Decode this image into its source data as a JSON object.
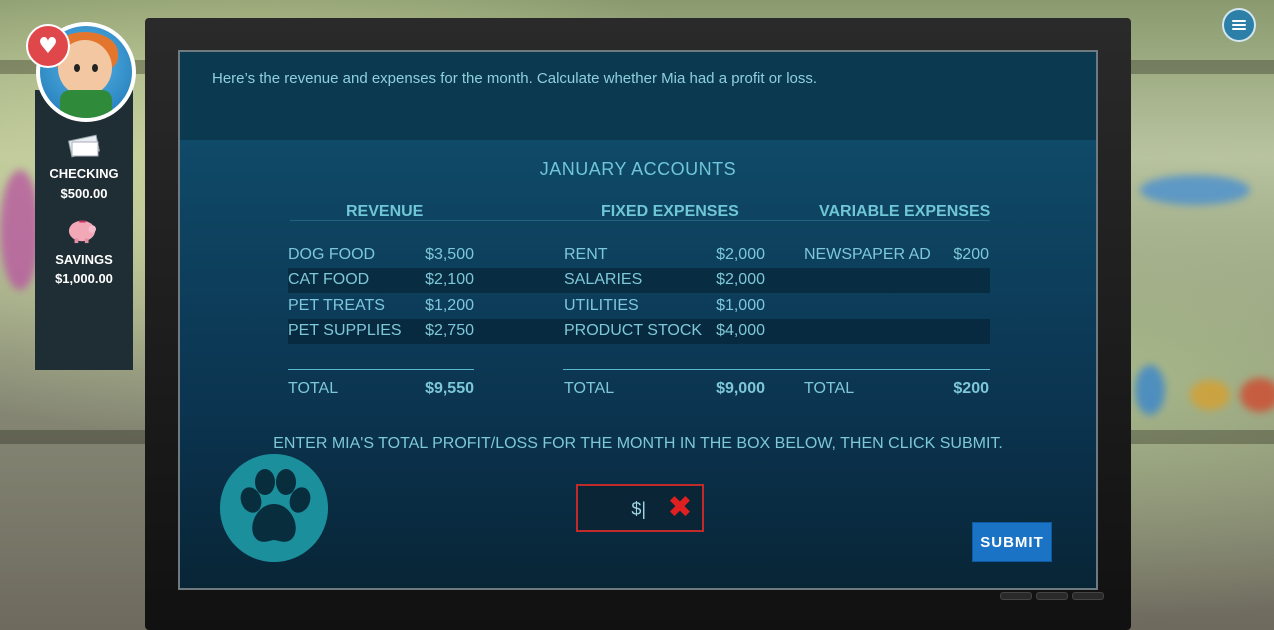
{
  "player": {
    "checking_label": "CHECKING",
    "checking_amount": "$500.00",
    "savings_label": "SAVINGS",
    "savings_amount": "$1,000.00"
  },
  "screen": {
    "instructions": "Here’s the revenue and expenses for the month. Calculate whether Mia had a profit or loss.",
    "title": "JANUARY ACCOUNTS",
    "revenue": {
      "heading": "REVENUE",
      "items": [
        {
          "label": "DOG FOOD",
          "amount": "$3,500"
        },
        {
          "label": "CAT FOOD",
          "amount": "$2,100"
        },
        {
          "label": "PET TREATS",
          "amount": "$1,200"
        },
        {
          "label": "PET SUPPLIES",
          "amount": "$2,750"
        }
      ],
      "total_label": "TOTAL",
      "total_amount": "$9,550"
    },
    "fixed": {
      "heading": "FIXED EXPENSES",
      "items": [
        {
          "label": "RENT",
          "amount": "$2,000"
        },
        {
          "label": "SALARIES",
          "amount": "$2,000"
        },
        {
          "label": "UTILITIES",
          "amount": "$1,000"
        },
        {
          "label": "PRODUCT STOCK",
          "amount": "$4,000"
        }
      ],
      "total_label": "TOTAL",
      "total_amount": "$9,000"
    },
    "variable": {
      "heading": "VARIABLE EXPENSES",
      "items": [
        {
          "label": "NEWSPAPER AD",
          "amount": "$200"
        }
      ],
      "total_label": "TOTAL",
      "total_amount": "$200"
    },
    "prompt": "ENTER MIA'S TOTAL PROFIT/LOSS FOR THE MONTH IN THE BOX BELOW, THEN CLICK SUBMIT.",
    "answer_value": "$|",
    "submit_label": "SUBMIT"
  },
  "colors": {
    "accent": "#6fc6d6",
    "submit": "#1a73c4",
    "error_border": "#c02a2a"
  }
}
